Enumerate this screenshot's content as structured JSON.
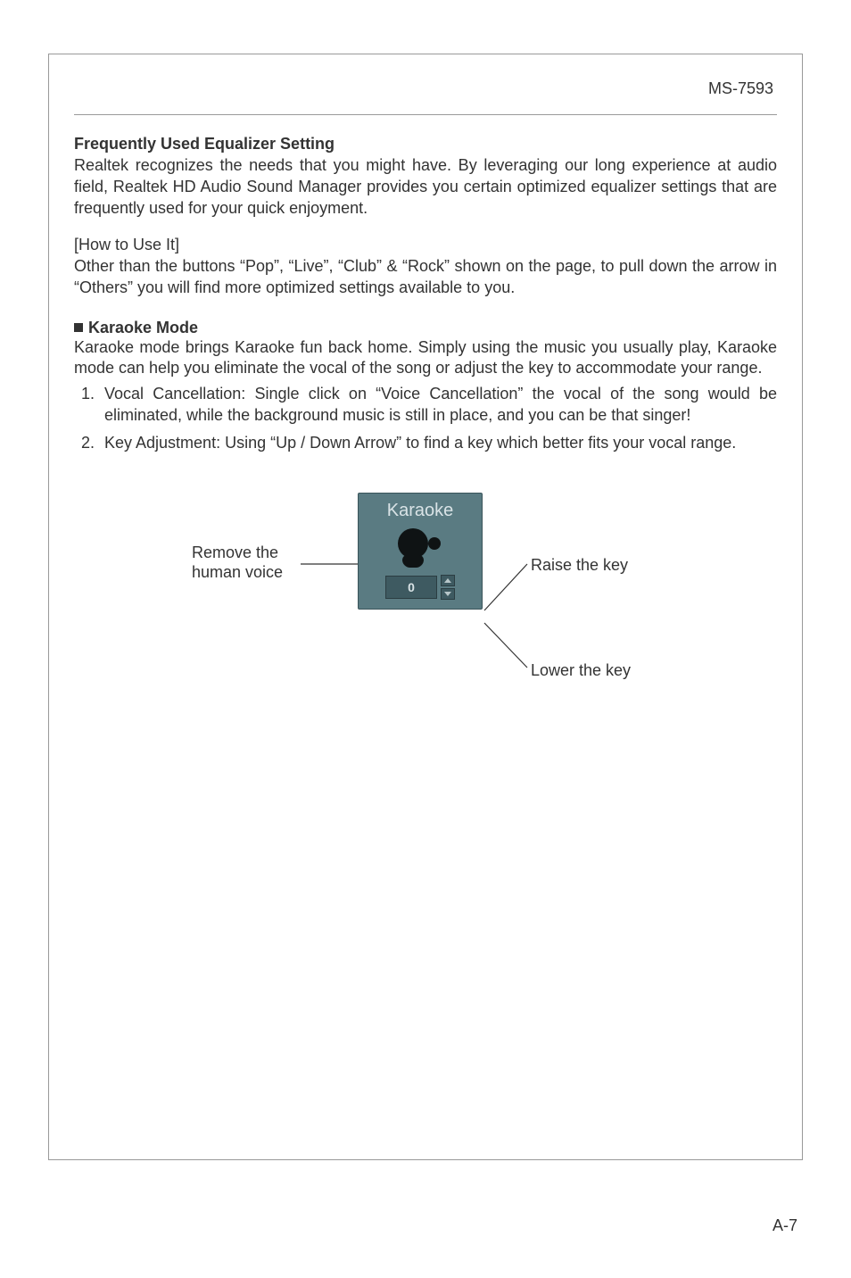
{
  "header": {
    "model": "MS-7593"
  },
  "eq": {
    "title": "Frequently Used Equalizer Setting",
    "para": "Realtek recognizes the needs that you might have. By leveraging our long experience at audio field, Realtek HD Audio Sound Manager provides you certain optimized equalizer settings that are frequently used for your quick enjoyment.",
    "howto_title": "[How to Use It]",
    "howto_body": "Other than the buttons “Pop”, “Live”, “Club” & “Rock” shown on the page, to pull down the arrow in “Others” you will find more optimized settings available to you."
  },
  "karaoke": {
    "title": "Karaoke Mode",
    "para": "Karaoke mode brings Karaoke fun back home. Simply using the music you usually play, Karaoke mode can help you eliminate the vocal of the song or adjust the key to accommodate your range.",
    "items": [
      "Vocal Cancellation: Single click on “Voice Cancellation” the vocal of the song would be eliminated, while the background music is still in place, and you can be that singer!",
      "Key Adjustment: Using “Up / Down Arrow” to find a key which better fits your vocal range."
    ]
  },
  "figure": {
    "widget_title": "Karaoke",
    "stepper_value": "0",
    "label_left": "Remove the human voice",
    "label_right_top": "Raise the key",
    "label_right_bottom": "Lower the key"
  },
  "footer": {
    "page_number": "A-7"
  }
}
